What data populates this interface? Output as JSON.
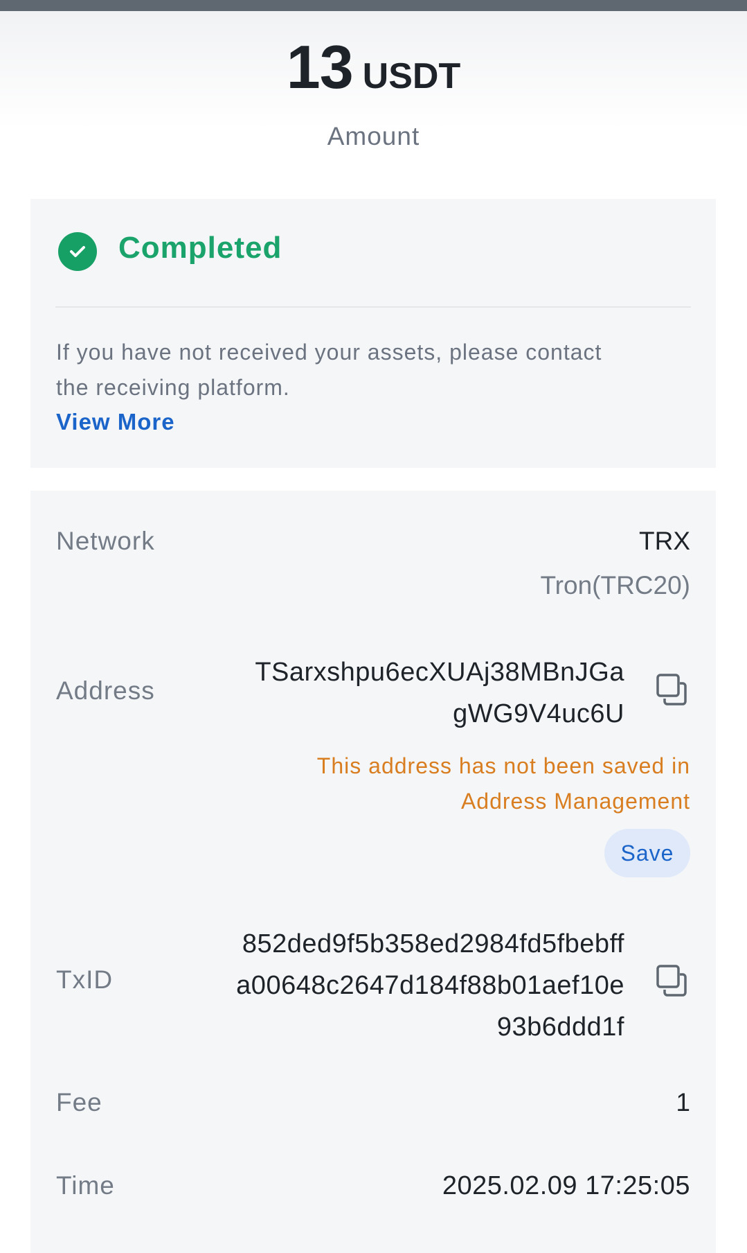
{
  "amount": {
    "value": "13",
    "unit": "USDT",
    "label": "Amount"
  },
  "status": {
    "text": "Completed",
    "color": "#1aa36b",
    "icon": "check-circle-icon",
    "notice_line1": "If you have not received your assets, please contact",
    "notice_line2": "the receiving platform.",
    "view_more": "View More"
  },
  "details": {
    "network": {
      "label": "Network",
      "value": "TRX",
      "sub": "Tron(TRC20)"
    },
    "address": {
      "label": "Address",
      "line1": "TSarxshpu6ecXUAj38MBnJGa",
      "line2": "gWG9V4uc6U",
      "warning_line1": "This address has not been saved in",
      "warning_line2": "Address Management",
      "save_label": "Save",
      "copy_icon": "copy-icon"
    },
    "txid": {
      "label": "TxID",
      "line1": "852ded9f5b358ed2984fd5fbebff",
      "line2": "a00648c2647d184f88b01aef10e",
      "line3": "93b6ddd1f",
      "copy_icon": "copy-icon"
    },
    "fee": {
      "label": "Fee",
      "value": "1"
    },
    "time": {
      "label": "Time",
      "value": "2025.02.09 17:25:05"
    }
  },
  "colors": {
    "accent_blue": "#1b64c9",
    "warning_orange": "#d97e20",
    "success_green": "#16a066"
  }
}
